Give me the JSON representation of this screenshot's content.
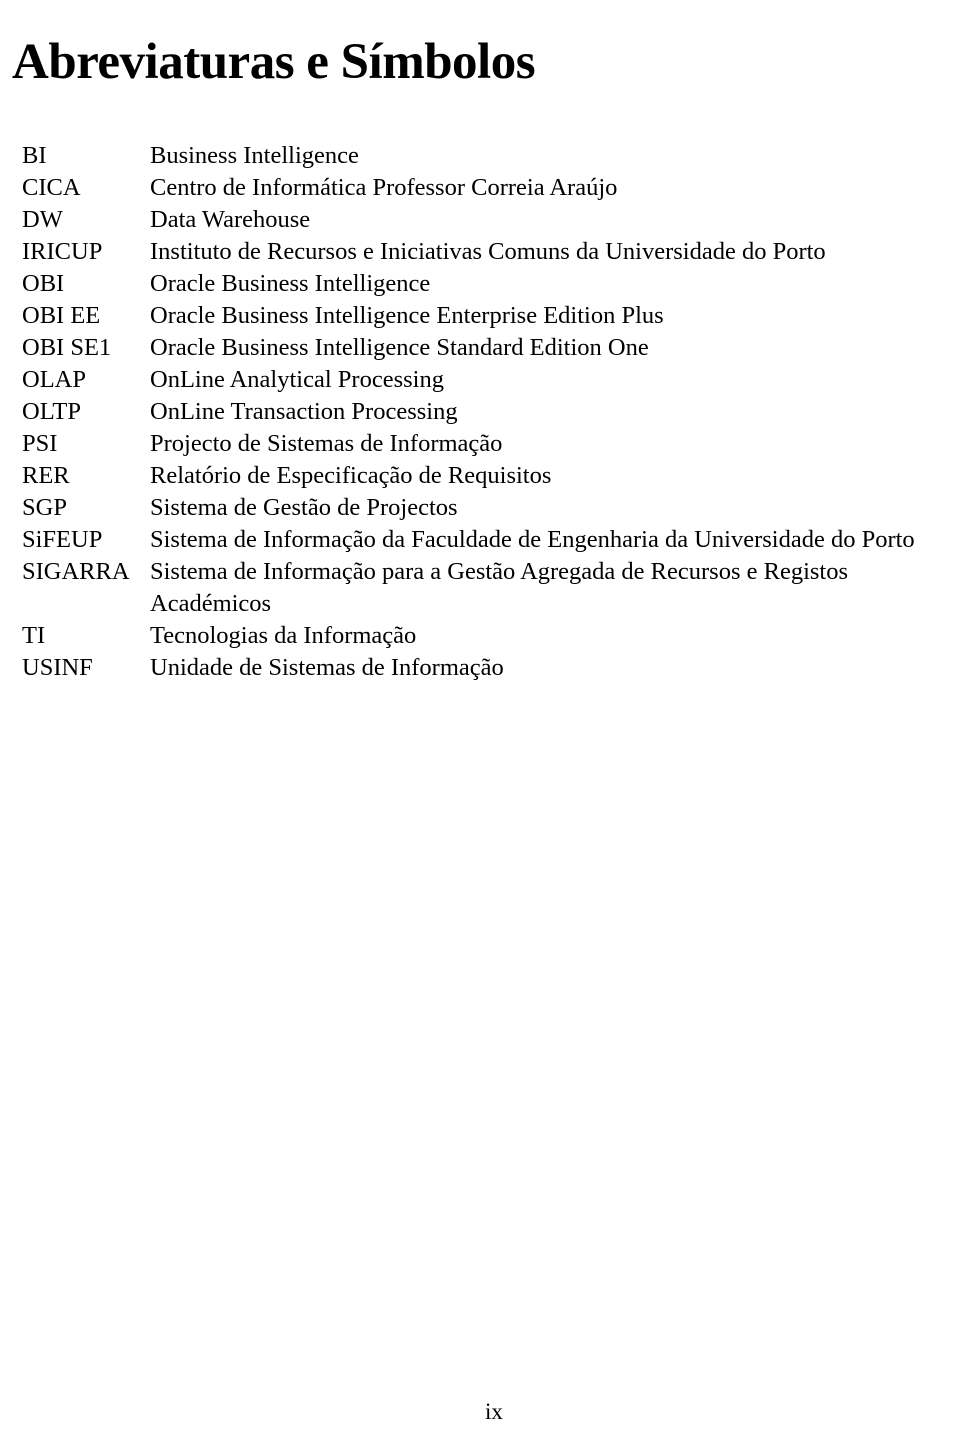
{
  "document": {
    "title": "Abreviaturas e Símbolos",
    "page_number": "ix"
  },
  "abbreviations": [
    {
      "term": "BI",
      "definition": "Business Intelligence"
    },
    {
      "term": "CICA",
      "definition": "Centro de Informática Professor Correia Araújo"
    },
    {
      "term": "DW",
      "definition": "Data Warehouse"
    },
    {
      "term": "IRICUP",
      "definition": "Instituto de Recursos e Iniciativas Comuns da Universidade do Porto"
    },
    {
      "term": "OBI",
      "definition": "Oracle Business Intelligence"
    },
    {
      "term": "OBI EE",
      "definition": "Oracle Business Intelligence Enterprise Edition Plus"
    },
    {
      "term": "OBI SE1",
      "definition": "Oracle Business Intelligence Standard Edition One"
    },
    {
      "term": "OLAP",
      "definition": "OnLine Analytical Processing"
    },
    {
      "term": "OLTP",
      "definition": "OnLine Transaction Processing"
    },
    {
      "term": "PSI",
      "definition": "Projecto de Sistemas de Informação"
    },
    {
      "term": "RER",
      "definition": "Relatório de Especificação de Requisitos"
    },
    {
      "term": "SGP",
      "definition": "Sistema de Gestão de Projectos"
    },
    {
      "term": "SiFEUP",
      "definition": "Sistema de Informação da Faculdade de Engenharia da Universidade do Porto"
    },
    {
      "term": "SIGARRA",
      "definition": "Sistema de Informação para a Gestão Agregada de Recursos e Registos Académicos"
    },
    {
      "term": "TI",
      "definition": "Tecnologias da Informação"
    },
    {
      "term": "USINF",
      "definition": "Unidade de Sistemas de Informação"
    }
  ]
}
